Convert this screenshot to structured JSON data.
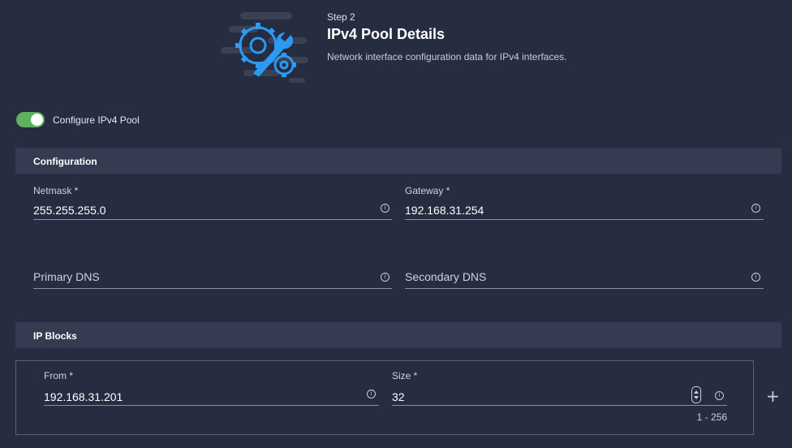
{
  "header": {
    "step": "Step 2",
    "title": "IPv4 Pool Details",
    "description": "Network interface configuration data for IPv4 interfaces.",
    "icon": "gear-wrench-icon"
  },
  "toggle": {
    "label": "Configure IPv4 Pool",
    "checked": true,
    "color": "#5fb15f"
  },
  "configuration": {
    "title": "Configuration",
    "netmask": {
      "label": "Netmask *",
      "value": "255.255.255.0"
    },
    "gateway": {
      "label": "Gateway *",
      "value": "192.168.31.254"
    },
    "primary_dns": {
      "placeholder": "Primary DNS"
    },
    "secondary_dns": {
      "placeholder": "Secondary DNS"
    }
  },
  "ip_blocks": {
    "title": "IP Blocks",
    "from": {
      "label": "From *",
      "value": "192.168.31.201"
    },
    "size": {
      "label": "Size *",
      "value": "32",
      "range": "1 - 256"
    },
    "add_icon": "+"
  },
  "colors": {
    "background": "#272d40",
    "section": "#353c52",
    "accent": "#2b9af3"
  }
}
